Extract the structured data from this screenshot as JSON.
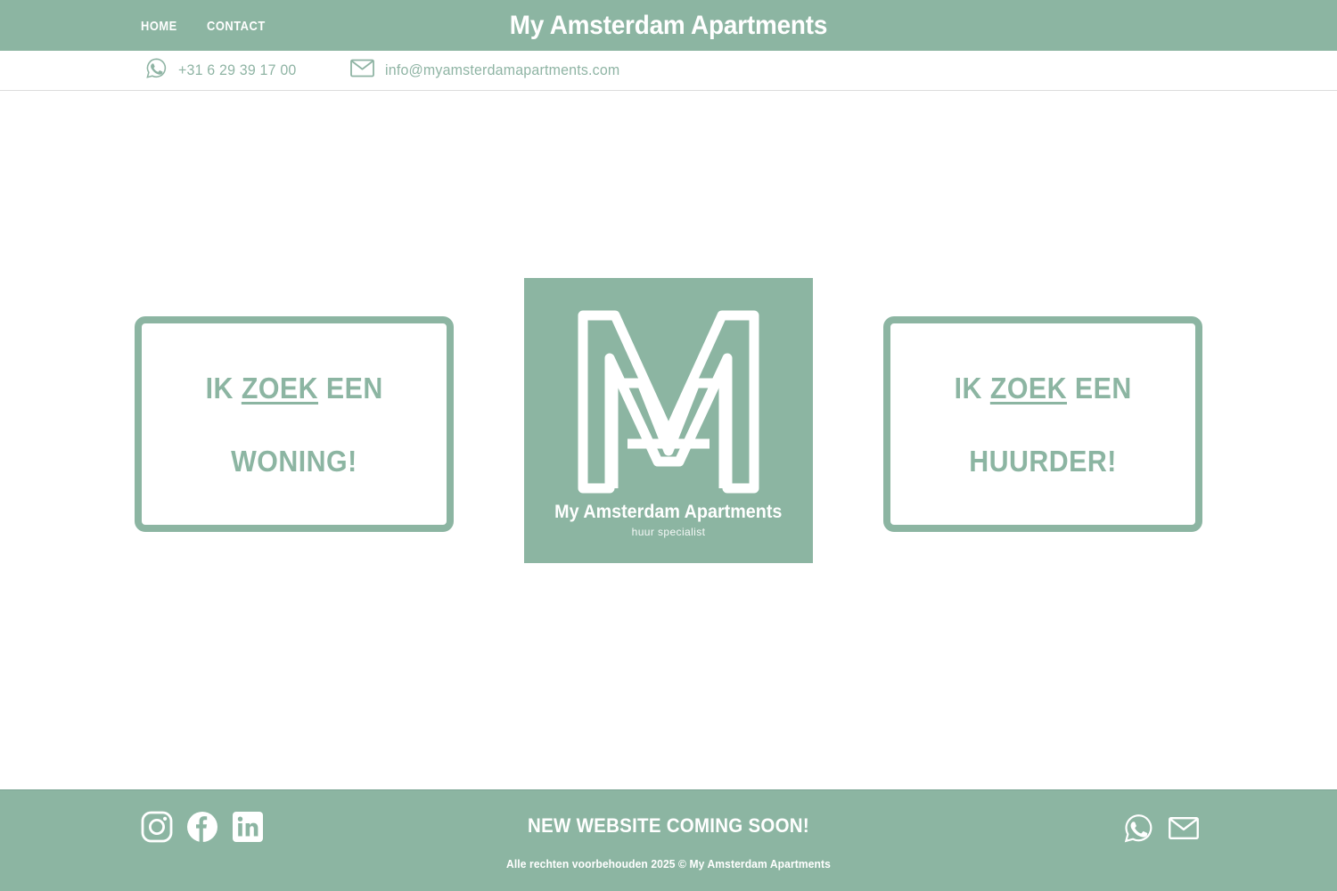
{
  "header": {
    "nav": [
      {
        "label": "HOME",
        "name": "nav-home"
      },
      {
        "label": "CONTACT",
        "name": "nav-contact"
      }
    ],
    "title": "My Amsterdam Apartments",
    "bg_color": "#8CB5A2"
  },
  "contact_bar": {
    "phone": {
      "icon": "whatsapp-icon",
      "value": "+31 6 29 39 17 00"
    },
    "email": {
      "icon": "mail-icon",
      "value": "info@myamsterdamapartments.com"
    },
    "text_color": "#8FB4A4"
  },
  "main": {
    "cta_left": {
      "line1_prefix": "IK ",
      "line1_underlined": "ZOEK",
      "line1_suffix": " EEN",
      "line2": "WONING!"
    },
    "cta_right": {
      "line1_prefix": "IK ",
      "line1_underlined": "ZOEK",
      "line1_suffix": " EEN",
      "line2": "HUURDER!"
    },
    "logo": {
      "mark": "m-a-monogram-icon",
      "name": "My Amsterdam Apartments",
      "subtitle": "huur specialist",
      "bg_color": "#8CB5A2"
    }
  },
  "footer": {
    "social": [
      {
        "name": "instagram-icon",
        "label": "Instagram"
      },
      {
        "name": "facebook-icon",
        "label": "Facebook"
      },
      {
        "name": "linkedin-icon",
        "label": "LinkedIn"
      }
    ],
    "headline": "NEW WEBSITE COMING SOON!",
    "copyright": "Alle rechten voorbehouden 2025 © My Amsterdam Apartments",
    "contact_icons": [
      {
        "name": "whatsapp-icon",
        "label": "WhatsApp"
      },
      {
        "name": "mail-icon",
        "label": "Email"
      }
    ],
    "bg_color": "#8CB5A2"
  }
}
